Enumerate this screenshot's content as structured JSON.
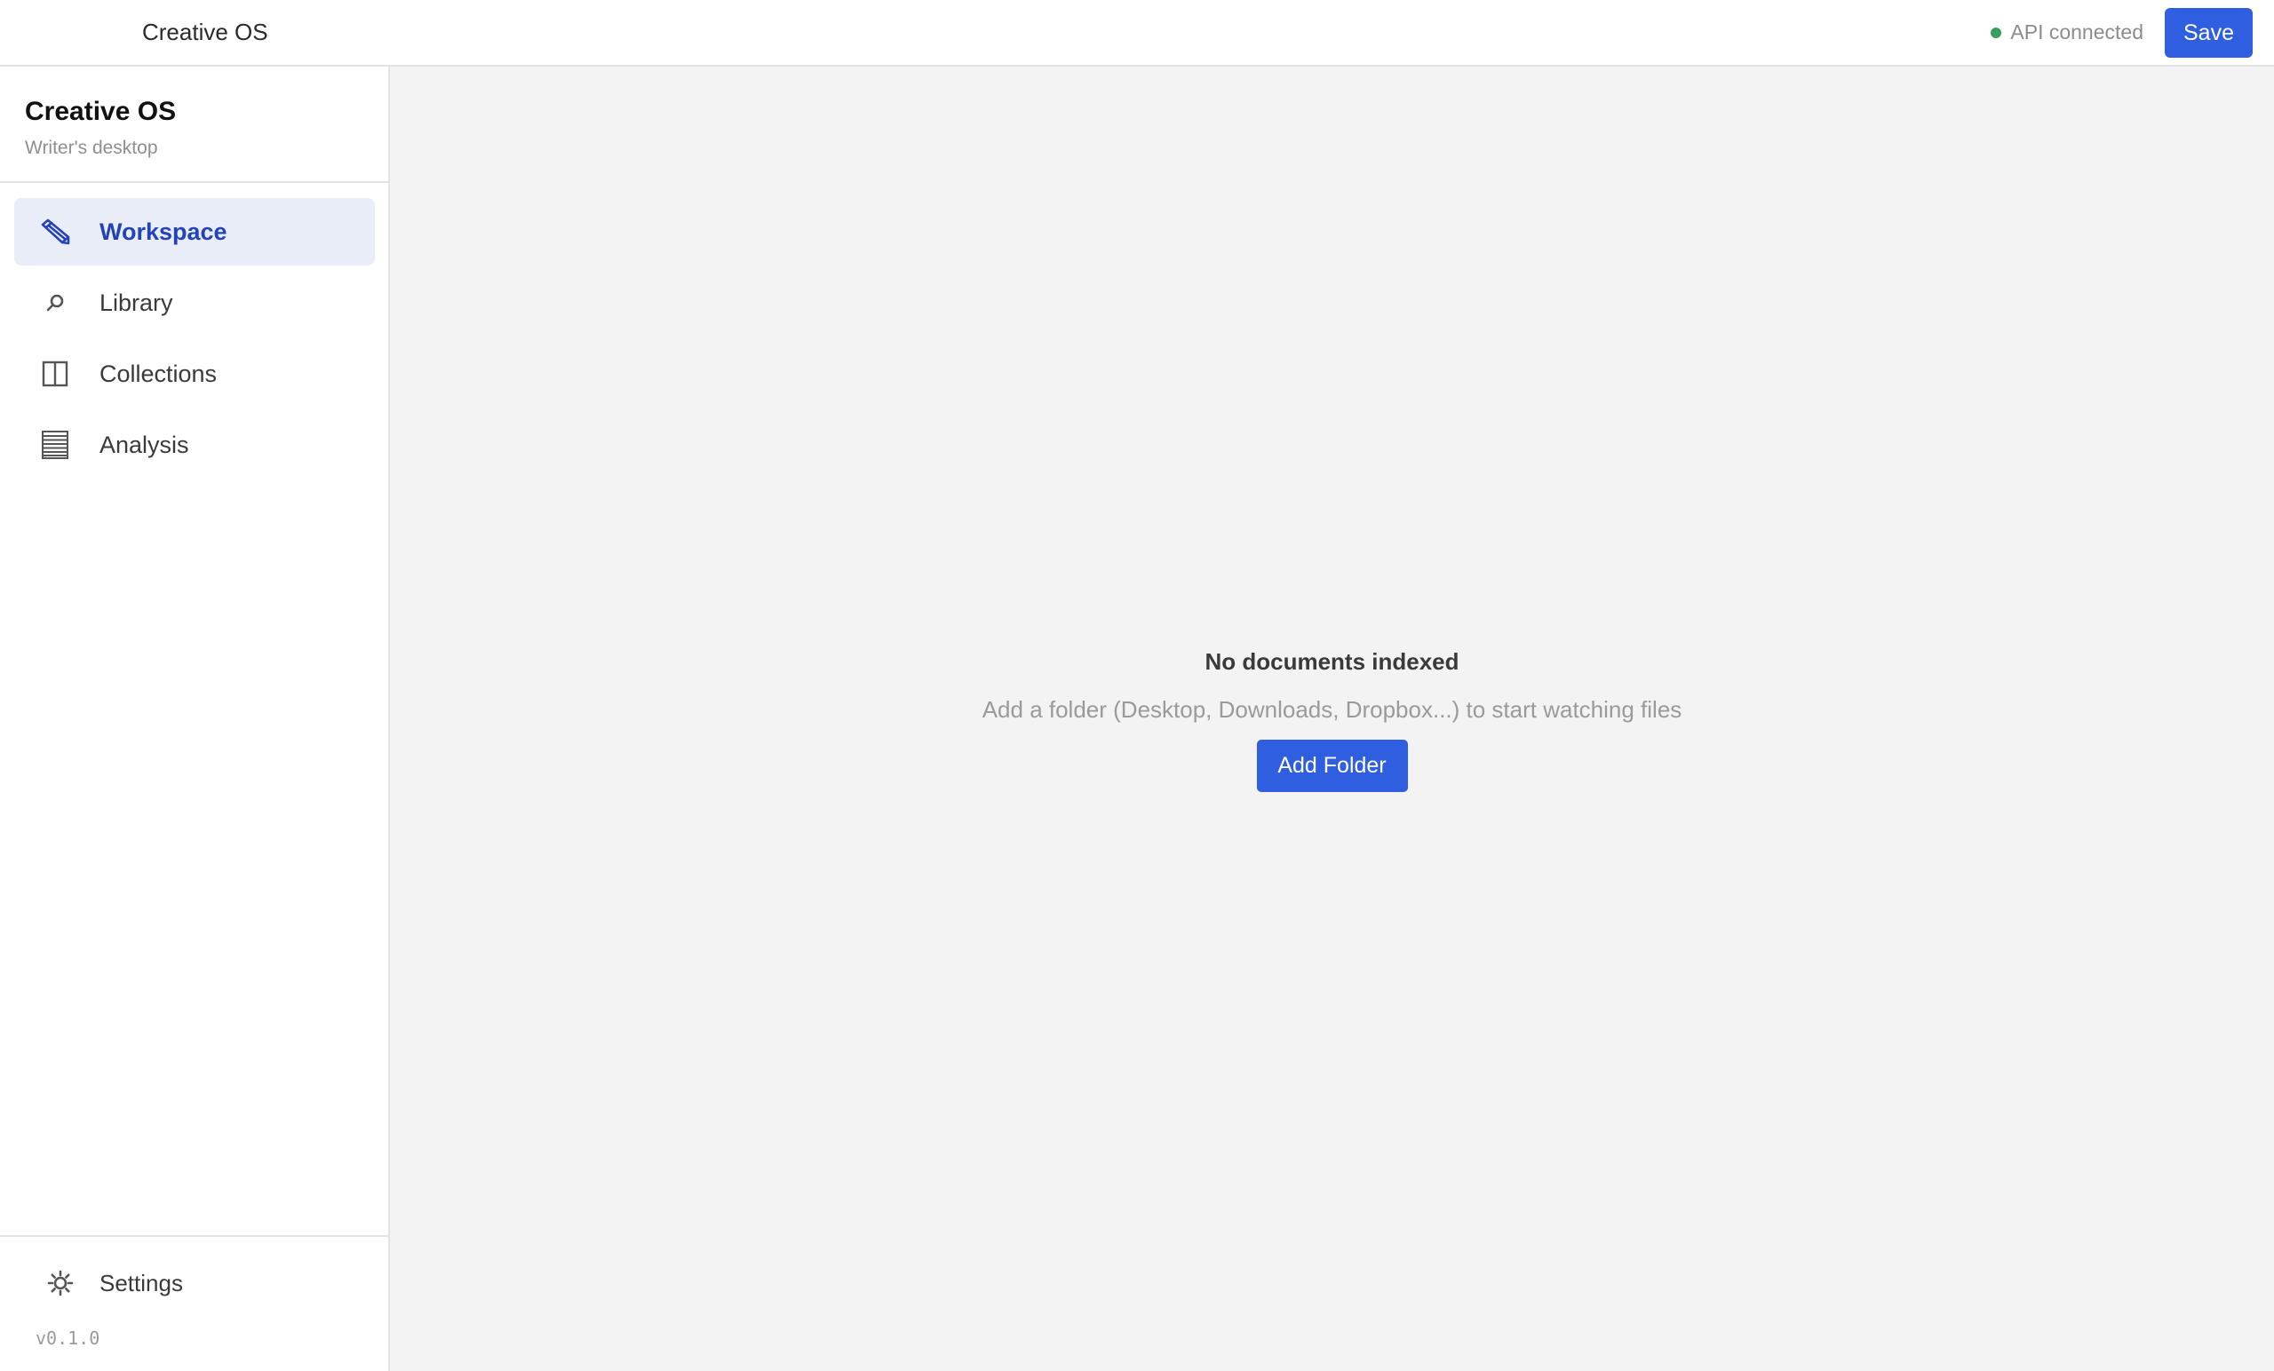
{
  "topbar": {
    "app_name": "Creative OS",
    "status_text": "API connected",
    "status_color": "#3a9d5d",
    "save_label": "Save"
  },
  "sidebar": {
    "brand_title": "Creative OS",
    "brand_subtitle": "Writer's desktop",
    "items": [
      {
        "label": "Workspace",
        "icon": "pencil-icon",
        "active": true
      },
      {
        "label": "Library",
        "icon": "search-icon",
        "active": false
      },
      {
        "label": "Collections",
        "icon": "columns-icon",
        "active": false
      },
      {
        "label": "Analysis",
        "icon": "table-icon",
        "active": false
      }
    ],
    "settings_label": "Settings",
    "settings_icon": "gear-icon",
    "version": "v0.1.0"
  },
  "main": {
    "empty_title": "No documents indexed",
    "empty_description": "Add a folder (Desktop, Downloads, Dropbox...) to start watching files",
    "add_folder_label": "Add Folder"
  },
  "colors": {
    "accent": "#2f5fe0",
    "active_nav_bg": "#e8edf8",
    "active_nav_text": "#2443b8"
  }
}
